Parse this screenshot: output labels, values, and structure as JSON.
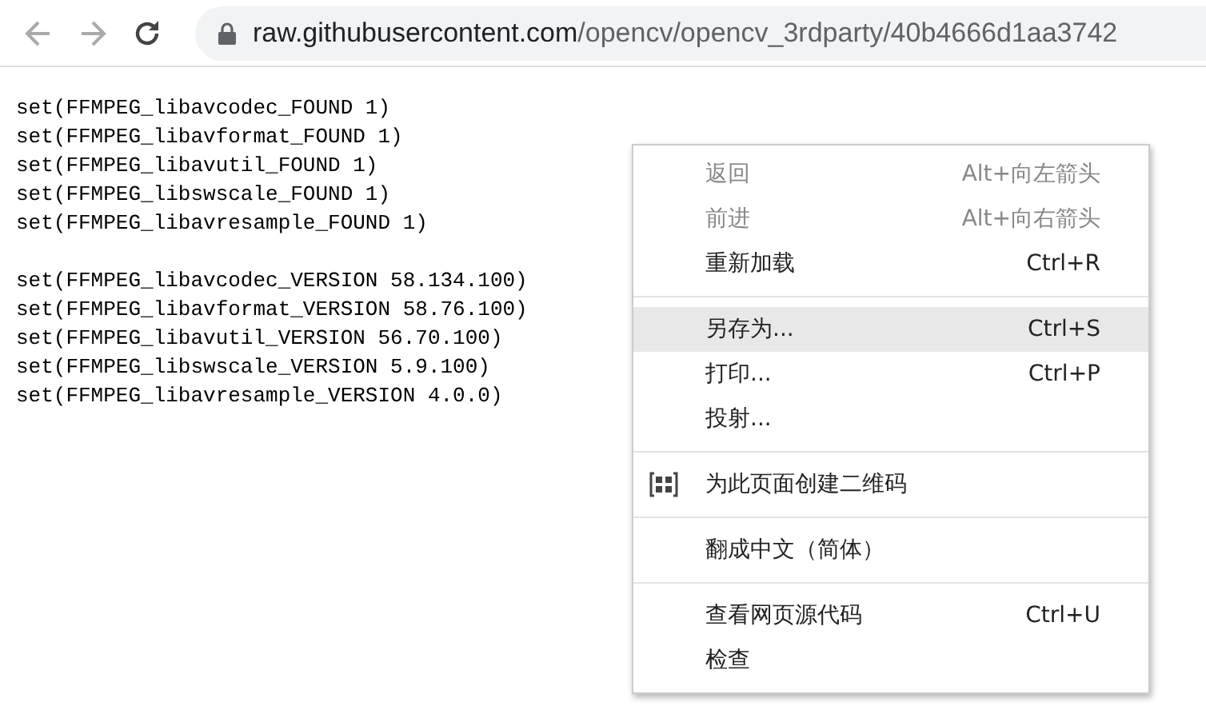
{
  "toolbar": {
    "back": {
      "disabled": true
    },
    "forward": {
      "disabled": true
    },
    "url": {
      "host": "raw.githubusercontent.com",
      "path": "/opencv/opencv_3rdparty/40b4666d1aa3742"
    }
  },
  "code_blocks": [
    {
      "lines": [
        "set(FFMPEG_libavcodec_FOUND 1)",
        "set(FFMPEG_libavformat_FOUND 1)",
        "set(FFMPEG_libavutil_FOUND 1)",
        "set(FFMPEG_libswscale_FOUND 1)",
        "set(FFMPEG_libavresample_FOUND 1)"
      ]
    },
    {
      "lines": [
        "set(FFMPEG_libavcodec_VERSION 58.134.100)",
        "set(FFMPEG_libavformat_VERSION 58.76.100)",
        "set(FFMPEG_libavutil_VERSION 56.70.100)",
        "set(FFMPEG_libswscale_VERSION 5.9.100)",
        "set(FFMPEG_libavresample_VERSION 4.0.0)"
      ]
    }
  ],
  "context_menu": {
    "groups": [
      {
        "items": [
          {
            "kind": "plain",
            "label": "返回",
            "shortcut": "Alt+向左箭头",
            "disabled": true,
            "selected": false
          },
          {
            "kind": "plain",
            "label": "前进",
            "shortcut": "Alt+向右箭头",
            "disabled": true,
            "selected": false
          },
          {
            "kind": "plain",
            "label": "重新加载",
            "shortcut": "Ctrl+R",
            "disabled": false,
            "selected": false
          }
        ]
      },
      {
        "items": [
          {
            "kind": "plain",
            "label": "另存为...",
            "shortcut": "Ctrl+S",
            "disabled": false,
            "selected": true
          },
          {
            "kind": "plain",
            "label": "打印...",
            "shortcut": "Ctrl+P",
            "disabled": false,
            "selected": false
          },
          {
            "kind": "plain",
            "label": "投射...",
            "disabled": false,
            "selected": false
          }
        ]
      },
      {
        "items": [
          {
            "kind": "qr",
            "label": "为此页面创建二维码",
            "disabled": false,
            "selected": false
          }
        ]
      },
      {
        "items": [
          {
            "kind": "plain",
            "label": "翻成中文（简体）",
            "disabled": false,
            "selected": false
          }
        ]
      },
      {
        "items": [
          {
            "kind": "plain",
            "label": "查看网页源代码",
            "shortcut": "Ctrl+U",
            "disabled": false,
            "selected": false
          },
          {
            "kind": "plain",
            "label": "检查",
            "disabled": false,
            "selected": false
          }
        ]
      }
    ]
  }
}
